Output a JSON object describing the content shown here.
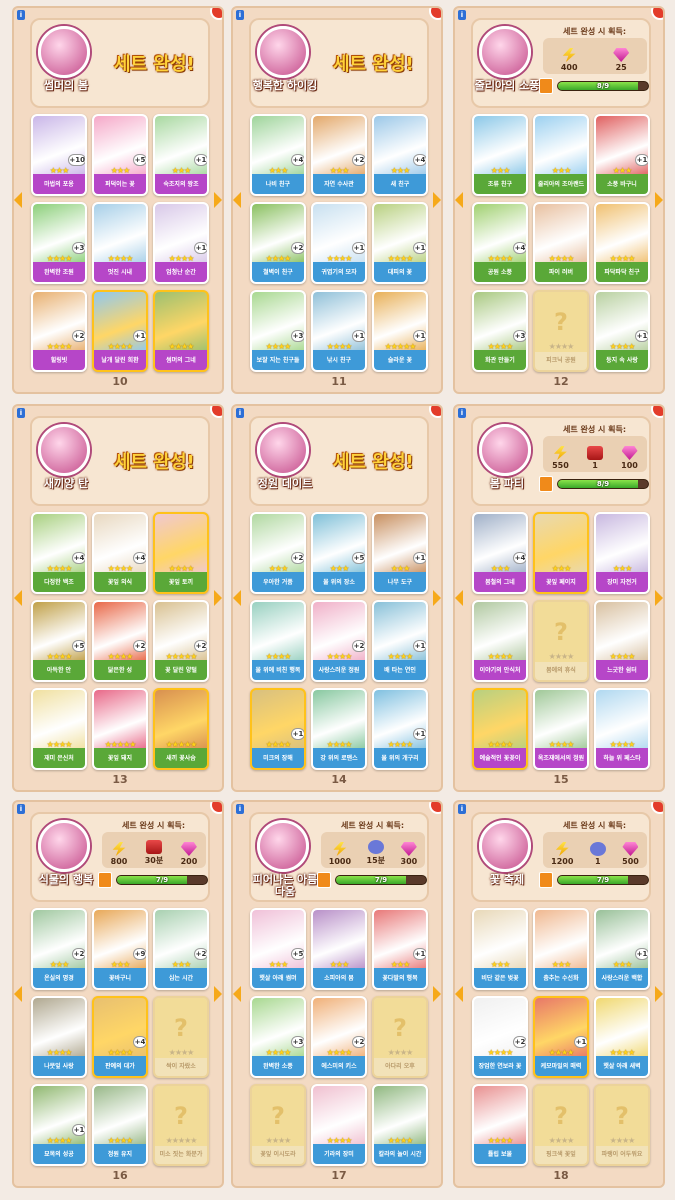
{
  "colors": {
    "label_purple": "#b646c8",
    "label_green": "#5aa838",
    "label_blue": "#3e9ad8",
    "label_tan": "#d8b878"
  },
  "panels": [
    {
      "page": "10",
      "set_name": "썸머의 봄",
      "complete_text": "세트 완성!",
      "theme": "purple",
      "cards": [
        {
          "label": "마법의 포옹",
          "stars": 3,
          "count": "10",
          "art": "#c9b6e8"
        },
        {
          "label": "퍼덕이는 꽃",
          "stars": 3,
          "count": "5",
          "art": "#f5a8c8"
        },
        {
          "label": "숙조지의 왕조",
          "stars": 3,
          "count": "1",
          "art": "#a8d8a0"
        },
        {
          "label": "완벽한 조원",
          "stars": 4,
          "count": "3",
          "art": "#8ccf7a"
        },
        {
          "label": "멋진 시내",
          "stars": 4,
          "count": "",
          "art": "#a7cfe8"
        },
        {
          "label": "엄청난 순간",
          "stars": 4,
          "count": "1",
          "art": "#d8c8e8"
        },
        {
          "label": "힐링빗",
          "stars": 4,
          "count": "2",
          "art": "#e8b070"
        },
        {
          "label": "날개 달린 희환",
          "stars": 4,
          "count": "1",
          "art": "#90c8f0",
          "gold": true
        },
        {
          "label": "썸머의 그네",
          "stars": 4,
          "count": "",
          "art": "#9cc070",
          "gold": true
        }
      ]
    },
    {
      "page": "11",
      "set_name": "행복한 하이킹",
      "complete_text": "세트 완성!",
      "theme": "blue",
      "cards": [
        {
          "label": "나비 친구",
          "stars": 3,
          "count": "4",
          "art": "#9ed49a"
        },
        {
          "label": "자연 수사관",
          "stars": 3,
          "count": "2",
          "art": "#e3a86a"
        },
        {
          "label": "새 친구",
          "stars": 3,
          "count": "4",
          "art": "#9cc8e8"
        },
        {
          "label": "철벽이 친구",
          "stars": 4,
          "count": "2",
          "art": "#8ac060"
        },
        {
          "label": "귀엽기의 모자",
          "stars": 4,
          "count": "1",
          "art": "#c8e0f0"
        },
        {
          "label": "대피의 꽃",
          "stars": 4,
          "count": "1",
          "art": "#b8d080"
        },
        {
          "label": "보잘 지는 친구들",
          "stars": 4,
          "count": "3",
          "art": "#a8d890"
        },
        {
          "label": "낚시 친구",
          "stars": 4,
          "count": "1",
          "art": "#90c0d8"
        },
        {
          "label": "슬라운 꽃",
          "stars": 5,
          "count": "1",
          "art": "#e8b058"
        }
      ]
    },
    {
      "page": "12",
      "set_name": "줄리아의 소풍",
      "reward_title": "세트 완성 시 획득:",
      "theme": "green",
      "rewards": [
        {
          "icon": "bolt",
          "value": "400"
        },
        {
          "icon": "gem",
          "value": "25"
        }
      ],
      "progress": {
        "text": "8/9",
        "ratio": 0.889
      },
      "cards": [
        {
          "label": "조류 친구",
          "stars": 3,
          "count": "",
          "art": "#8cc8e8"
        },
        {
          "label": "줄리아의 조아랜드",
          "stars": 3,
          "count": "",
          "art": "#9cd0f0"
        },
        {
          "label": "소풍 바구니",
          "stars": 3,
          "count": "1",
          "art": "#e06060"
        },
        {
          "label": "공원 소풍",
          "stars": 4,
          "count": "4",
          "art": "#a0d070"
        },
        {
          "label": "파이 러버",
          "stars": 4,
          "count": "",
          "art": "#e8c0a0"
        },
        {
          "label": "파닥파닥 친구",
          "stars": 4,
          "count": "",
          "art": "#f0c070"
        },
        {
          "label": "화관 만들기",
          "stars": 4,
          "count": "3",
          "art": "#a8c880"
        },
        {
          "label": "피크닉 공원",
          "stars": 4,
          "missing": true
        },
        {
          "label": "둥지 속 사랑",
          "stars": 4,
          "count": "1",
          "art": "#b8d0a0"
        }
      ]
    },
    {
      "page": "13",
      "set_name": "새끼양 탄",
      "complete_text": "세트 완성!",
      "theme": "green",
      "cards": [
        {
          "label": "다정한 백조",
          "stars": 4,
          "count": "4",
          "art": "#a8d080"
        },
        {
          "label": "꽃잎 외식",
          "stars": 4,
          "count": "4",
          "art": "#e8d8c0"
        },
        {
          "label": "꽃잎 토끼",
          "stars": 4,
          "count": "",
          "art": "#f0c8d0",
          "gold": true
        },
        {
          "label": "아득한 안",
          "stars": 4,
          "count": "5",
          "art": "#c0a048"
        },
        {
          "label": "닮은한 성",
          "stars": 4,
          "count": "2",
          "art": "#e86848"
        },
        {
          "label": "꽃 달린 양털",
          "stars": 5,
          "count": "2",
          "art": "#d8c090"
        },
        {
          "label": "재미 은신처",
          "stars": 4,
          "count": "",
          "art": "#f0e0a0"
        },
        {
          "label": "꽃잎 돼지",
          "stars": 5,
          "count": "",
          "art": "#e86888"
        },
        {
          "label": "새끼 꽃사슴",
          "stars": 5,
          "count": "",
          "art": "#d89050",
          "gold": true
        }
      ]
    },
    {
      "page": "14",
      "set_name": "정원 데이트",
      "complete_text": "세트 완성!",
      "theme": "blue",
      "cards": [
        {
          "label": "우아한 거품",
          "stars": 3,
          "count": "2",
          "art": "#b0d8a0"
        },
        {
          "label": "물 위의 장소",
          "stars": 3,
          "count": "5",
          "art": "#80c0d8"
        },
        {
          "label": "나무 도구",
          "stars": 3,
          "count": "1",
          "art": "#c89060"
        },
        {
          "label": "물 위에 비친 행복",
          "stars": 4,
          "count": "",
          "art": "#98d0c0"
        },
        {
          "label": "사랑스러운 정원",
          "stars": 4,
          "count": "2",
          "art": "#f0b0c8"
        },
        {
          "label": "배 타는 연인",
          "stars": 4,
          "count": "1",
          "art": "#88c0d8"
        },
        {
          "label": "미크의 장해",
          "stars": 4,
          "count": "1",
          "art": "#d8c080",
          "gold": true
        },
        {
          "label": "강 위의 로맨스",
          "stars": 4,
          "count": "",
          "art": "#88c8a0"
        },
        {
          "label": "물 위의 개구리",
          "stars": 4,
          "count": "1",
          "art": "#80c0e0"
        }
      ]
    },
    {
      "page": "15",
      "set_name": "봄 파티",
      "reward_title": "세트 완성 시 획득:",
      "theme": "purple",
      "rewards": [
        {
          "icon": "bolt",
          "value": "550"
        },
        {
          "icon": "box",
          "value": "1"
        },
        {
          "icon": "gem",
          "value": "100"
        }
      ],
      "progress": {
        "text": "8/9",
        "ratio": 0.889
      },
      "cards": [
        {
          "label": "봄철의 그네",
          "stars": 3,
          "count": "4",
          "art": "#a0b0c8"
        },
        {
          "label": "꽃잎 페이지",
          "stars": 3,
          "count": "",
          "art": "#e8d8b0",
          "gold": true
        },
        {
          "label": "장미 자전거",
          "stars": 3,
          "count": "",
          "art": "#c8b8e0"
        },
        {
          "label": "이야기의 안식처",
          "stars": 4,
          "count": "",
          "art": "#b0c8a0"
        },
        {
          "label": "봄에의 휴식",
          "stars": 4,
          "missing": true
        },
        {
          "label": "느긋한 쉼터",
          "stars": 4,
          "count": "",
          "art": "#d8c0a0"
        },
        {
          "label": "예술적인 꽃꽂이",
          "stars": 4,
          "count": "",
          "art": "#b8d080",
          "gold": true
        },
        {
          "label": "옥조재에서의 정원",
          "stars": 4,
          "count": "",
          "art": "#a0c898"
        },
        {
          "label": "하늘 위 페스타",
          "stars": 4,
          "count": "",
          "art": "#b0d8f0"
        }
      ]
    },
    {
      "page": "16",
      "set_name": "식물의 행복",
      "reward_title": "세트 완성 시 획득:",
      "theme": "blue",
      "rewards": [
        {
          "icon": "bolt",
          "value": "800"
        },
        {
          "icon": "box",
          "value": "30분"
        },
        {
          "icon": "gem",
          "value": "200"
        }
      ],
      "progress": {
        "text": "7/9",
        "ratio": 0.778
      },
      "cards": [
        {
          "label": "온실의 명경",
          "stars": 3,
          "count": "2",
          "art": "#a0c8a0"
        },
        {
          "label": "꽃바구니",
          "stars": 3,
          "count": "9",
          "art": "#e8a858"
        },
        {
          "label": "심는 시간",
          "stars": 3,
          "count": "2",
          "art": "#a8d0b0"
        },
        {
          "label": "나뭇잎 사랑",
          "stars": 4,
          "count": "",
          "art": "#b0a890"
        },
        {
          "label": "판예의 대가",
          "stars": 4,
          "count": "4",
          "art": "#e8c070",
          "gold": true
        },
        {
          "label": "싹이 자랐소",
          "stars": 4,
          "missing": true
        },
        {
          "label": "묘목의 성공",
          "stars": 4,
          "count": "1",
          "art": "#90b870"
        },
        {
          "label": "정원 유지",
          "stars": 4,
          "count": "",
          "art": "#98b888"
        },
        {
          "label": "미소 짓는 화분가",
          "stars": 5,
          "missing": true
        }
      ]
    },
    {
      "page": "17",
      "set_name": "피어나는 아름다움",
      "reward_title": "세트 완성 시 획득:",
      "theme": "blue",
      "rewards": [
        {
          "icon": "bolt",
          "value": "1000"
        },
        {
          "icon": "clock",
          "value": "15분"
        },
        {
          "icon": "gem",
          "value": "300"
        }
      ],
      "progress": {
        "text": "7/9",
        "ratio": 0.778
      },
      "cards": [
        {
          "label": "햇살 아래 썸머",
          "stars": 3,
          "count": "5",
          "art": "#f0c0d8"
        },
        {
          "label": "소피아의 봄",
          "stars": 3,
          "count": "",
          "art": "#b890c8"
        },
        {
          "label": "꽃다발의 행복",
          "stars": 3,
          "count": "1",
          "art": "#e87878"
        },
        {
          "label": "완벽한 소풍",
          "stars": 4,
          "count": "3",
          "art": "#a8d890"
        },
        {
          "label": "에스미의 키스",
          "stars": 4,
          "count": "2",
          "art": "#f0b078"
        },
        {
          "label": "아다리 오후",
          "stars": 4,
          "missing": true
        },
        {
          "label": "꽃잎 이시도라",
          "stars": 4,
          "missing": true
        },
        {
          "label": "기라의 장미",
          "stars": 4,
          "count": "",
          "art": "#f0c0d0"
        },
        {
          "label": "칼라의 놀이 시간",
          "stars": 4,
          "count": "",
          "art": "#90b880"
        }
      ]
    },
    {
      "page": "18",
      "set_name": "꽃 축제",
      "reward_title": "세트 완성 시 획득:",
      "theme": "blue",
      "rewards": [
        {
          "icon": "bolt",
          "value": "1200"
        },
        {
          "icon": "clock",
          "value": "1"
        },
        {
          "icon": "gem",
          "value": "500"
        }
      ],
      "progress": {
        "text": "7/9",
        "ratio": 0.778
      },
      "cards": [
        {
          "label": "비단 같은 벚꽃",
          "stars": 3,
          "count": "",
          "art": "#e8d8b8"
        },
        {
          "label": "춤추는 수선화",
          "stars": 3,
          "count": "",
          "art": "#f0b890"
        },
        {
          "label": "사랑스러운 백합",
          "stars": 3,
          "count": "1",
          "art": "#98c098"
        },
        {
          "label": "장엄한 연보라 꽃",
          "stars": 4,
          "count": "2",
          "art": "#f0f0f0"
        },
        {
          "label": "케모마일의 매력",
          "stars": 4,
          "count": "1",
          "art": "#e87868",
          "gold": true
        },
        {
          "label": "햇살 아래 새벽",
          "stars": 4,
          "count": "",
          "art": "#f0d870"
        },
        {
          "label": "튤립 보물",
          "stars": 4,
          "count": "",
          "art": "#e89090"
        },
        {
          "label": "핑크색 꽃잎",
          "stars": 4,
          "missing": true
        },
        {
          "label": "파랭이 어두워요",
          "stars": 4,
          "missing": true
        }
      ]
    }
  ]
}
